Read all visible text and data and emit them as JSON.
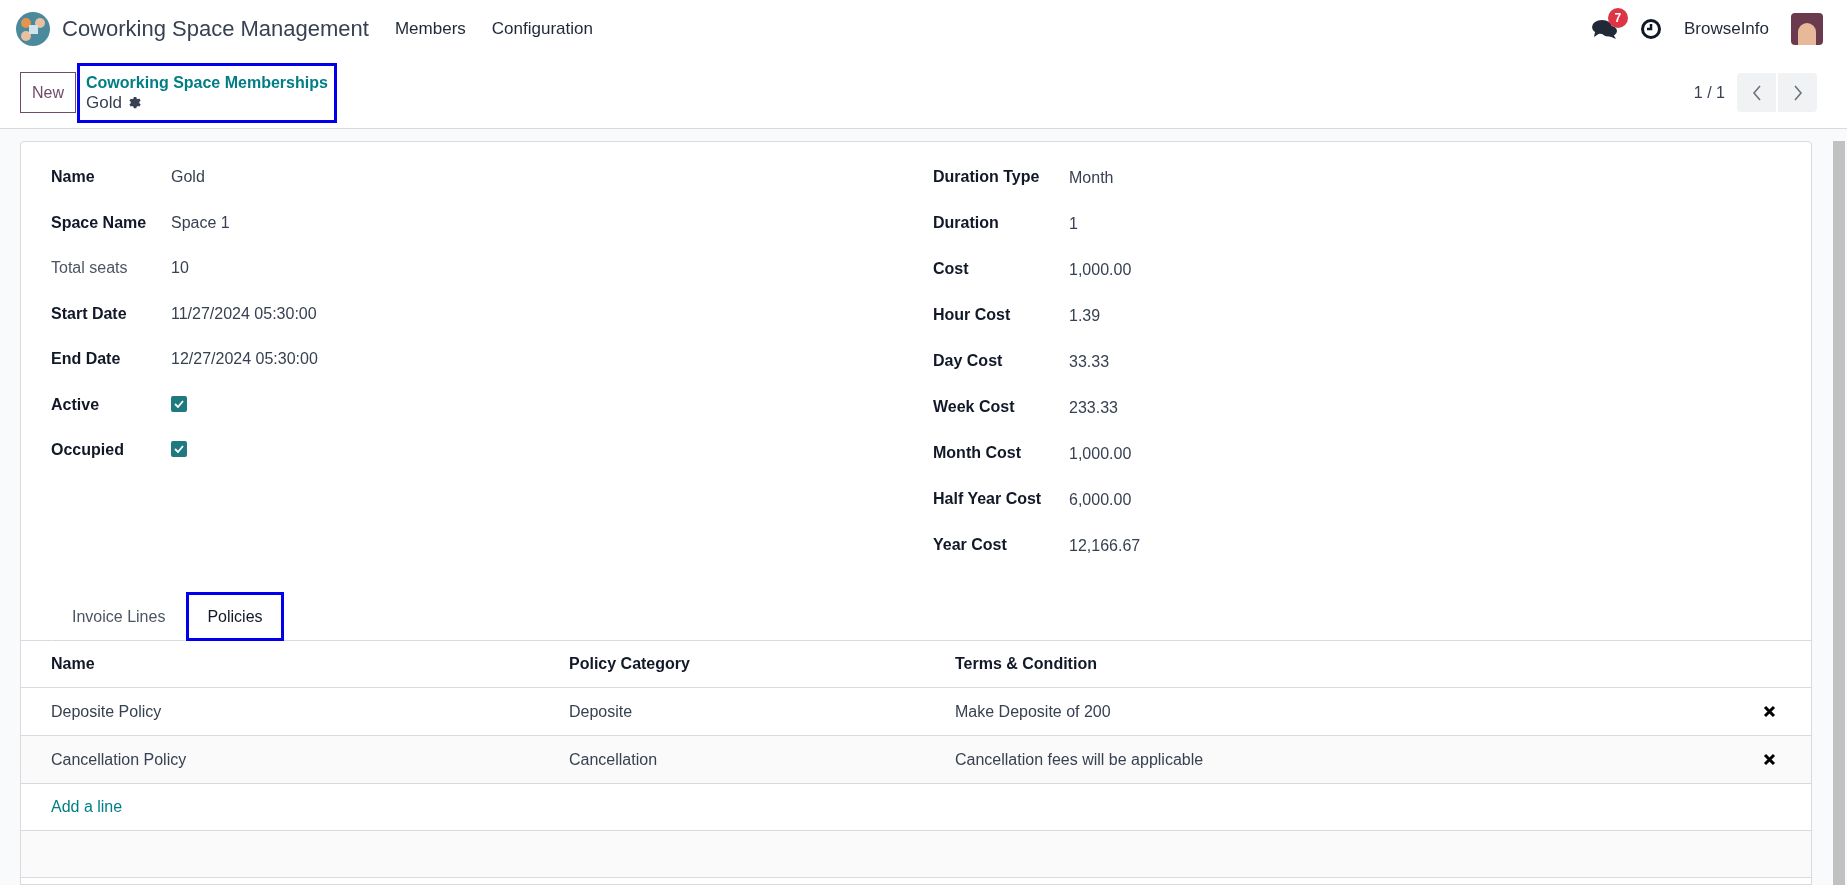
{
  "navbar": {
    "app_title": "Coworking Space Management",
    "menu": [
      "Members",
      "Configuration"
    ],
    "message_count": "7",
    "user": "BrowseInfo"
  },
  "control_panel": {
    "new_button": "New",
    "breadcrumb": {
      "parent": "Coworking Space Memberships",
      "current": "Gold",
      "highlighted": true
    },
    "pager": "1 / 1"
  },
  "form": {
    "left_fields": [
      {
        "label": "Name",
        "kind": "text",
        "value": "Gold",
        "muted": false
      },
      {
        "label": "Space Name",
        "kind": "text",
        "value": "Space 1",
        "muted": false
      },
      {
        "label": "Total seats",
        "kind": "text",
        "value": "10",
        "muted": true
      },
      {
        "label": "Start Date",
        "kind": "text",
        "value": "11/27/2024 05:30:00",
        "muted": false
      },
      {
        "label": "End Date",
        "kind": "text",
        "value": "12/27/2024 05:30:00",
        "muted": false
      },
      {
        "label": "Active",
        "kind": "checkbox",
        "checked": true,
        "muted": false
      },
      {
        "label": "Occupied",
        "kind": "checkbox",
        "checked": true,
        "muted": false
      }
    ],
    "right_fields": [
      {
        "label": "Duration Type",
        "value": "Month"
      },
      {
        "label": "Duration",
        "value": "1"
      },
      {
        "label": "Cost",
        "value": "1,000.00"
      },
      {
        "label": "Hour Cost",
        "value": "1.39"
      },
      {
        "label": "Day Cost",
        "value": "33.33"
      },
      {
        "label": "Week Cost",
        "value": "233.33"
      },
      {
        "label": "Month Cost",
        "value": "1,000.00"
      },
      {
        "label": "Half Year Cost",
        "value": "6,000.00"
      },
      {
        "label": "Year Cost",
        "value": "12,166.67"
      }
    ],
    "tabs": [
      {
        "label": "Invoice Lines",
        "selected": false,
        "highlighted": false
      },
      {
        "label": "Policies",
        "selected": true,
        "highlighted": true
      }
    ],
    "table": {
      "columns": [
        "Name",
        "Policy Category",
        "Terms & Condition"
      ],
      "rows": [
        [
          "Deposite Policy",
          "Deposite",
          "Make Deposite of 200"
        ],
        [
          "Cancellation Policy",
          "Cancellation",
          "Cancellation fees will be applicable"
        ]
      ],
      "add_line": "Add a line"
    }
  }
}
